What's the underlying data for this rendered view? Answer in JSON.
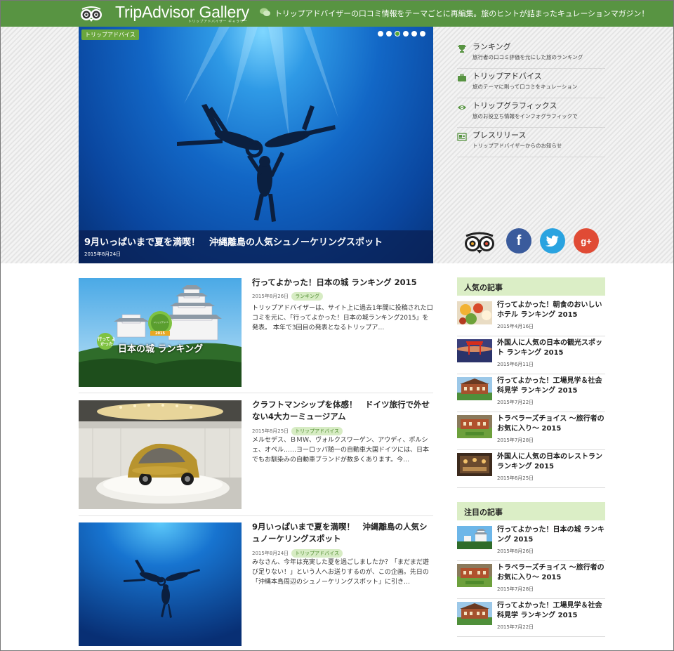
{
  "header": {
    "logo_text": "TripAdvisor Gallery",
    "logo_sub": "トリップアドバイザー ギャラリー",
    "tagline": "トリップアドバイザーの口コミ情報をテーマごとに再編集。旅のヒントが詰まったキュレーションマガジン！",
    "bg_color": "#589442"
  },
  "hero": {
    "badge": "トリップアドバイス",
    "title": "9月いっぱいまで夏を満喫！　沖縄離島の人気シュノーケリングスポット",
    "date": "2015年8月24日",
    "slide_count": 6,
    "active_slide": 3
  },
  "categories": [
    {
      "icon": "trophy-icon",
      "title": "ランキング",
      "desc": "旅行者の口コミ評価を元にした旅のランキング"
    },
    {
      "icon": "briefcase-icon",
      "title": "トリップアドバイス",
      "desc": "旅のテーマに則って口コミをキュレーション"
    },
    {
      "icon": "eye-icon",
      "title": "トリップグラフィックス",
      "desc": "旅のお役立ち情報をインフォグラフィックで"
    },
    {
      "icon": "press-release-icon",
      "title": "プレスリリース",
      "desc": "トリップアドバイザーからのお知らせ"
    }
  ],
  "social": {
    "facebook": "f",
    "twitter": "t",
    "googleplus": "g+"
  },
  "articles": [
    {
      "title": "行ってよかった！日本の城 ランキング 2015",
      "date": "2015年8月26日",
      "tag": "ランキング",
      "excerpt": "トリップアドバイザーは、サイト上に過去1年間に投稿された口コミを元に、「行ってよかった！日本の城ランキング2015」を発表。 本年で3回目の発表となるトリップア…",
      "thumb_caption": "日本の城 ランキング",
      "thumb_badge_left": "行って よかった",
      "thumb_badge_right": "トリップアドバイザー",
      "thumb_badge_year": "2015"
    },
    {
      "title": "クラフトマンシップを体感！　ドイツ旅行で外せない4大カーミュージアム",
      "date": "2015年8月25日",
      "tag": "トリップアドバイス",
      "excerpt": "メルセデス、ＢＭＷ、ヴォルクスワーゲン、アウディ、ポルシェ、オペル……ヨーロッパ随一の自動車大国ドイツには、日本でもお馴染みの自動車ブランドが数多くあります。今…"
    },
    {
      "title": "9月いっぱいまで夏を満喫！　沖縄離島の人気シュノーケリングスポット",
      "date": "2015年8月24日",
      "tag": "トリップアドバイス",
      "excerpt": "みなさん、今年は充実した夏を過ごしましたか？「まだまだ遊び足りない！」という人へお送りするのが、この企画。先日の「沖縄本島周辺のシュノーケリングスポット」に引き…"
    }
  ],
  "popular": {
    "heading": "人気の記事",
    "items": [
      {
        "title": "行ってよかった！朝食のおいしいホテル ランキング 2015",
        "date": "2015年4月16日"
      },
      {
        "title": "外国人に人気の日本の観光スポット ランキング 2015",
        "date": "2015年6月11日"
      },
      {
        "title": "行ってよかった！工場見学＆社会科見学 ランキング 2015",
        "date": "2015年7月22日"
      },
      {
        "title": "トラベラーズチョイス ～旅行者のお気に入り～ 2015",
        "date": "2015年7月28日"
      },
      {
        "title": "外国人に人気の日本のレストラン ランキング 2015",
        "date": "2015年6月25日"
      }
    ]
  },
  "featured": {
    "heading": "注目の記事",
    "items": [
      {
        "title": "行ってよかった！日本の城 ランキング 2015",
        "date": "2015年8月26日"
      },
      {
        "title": "トラベラーズチョイス ～旅行者のお気に入り～ 2015",
        "date": "2015年7月28日"
      },
      {
        "title": "行ってよかった！工場見学＆社会科見学 ランキング 2015",
        "date": "2015年7月22日"
      }
    ]
  }
}
